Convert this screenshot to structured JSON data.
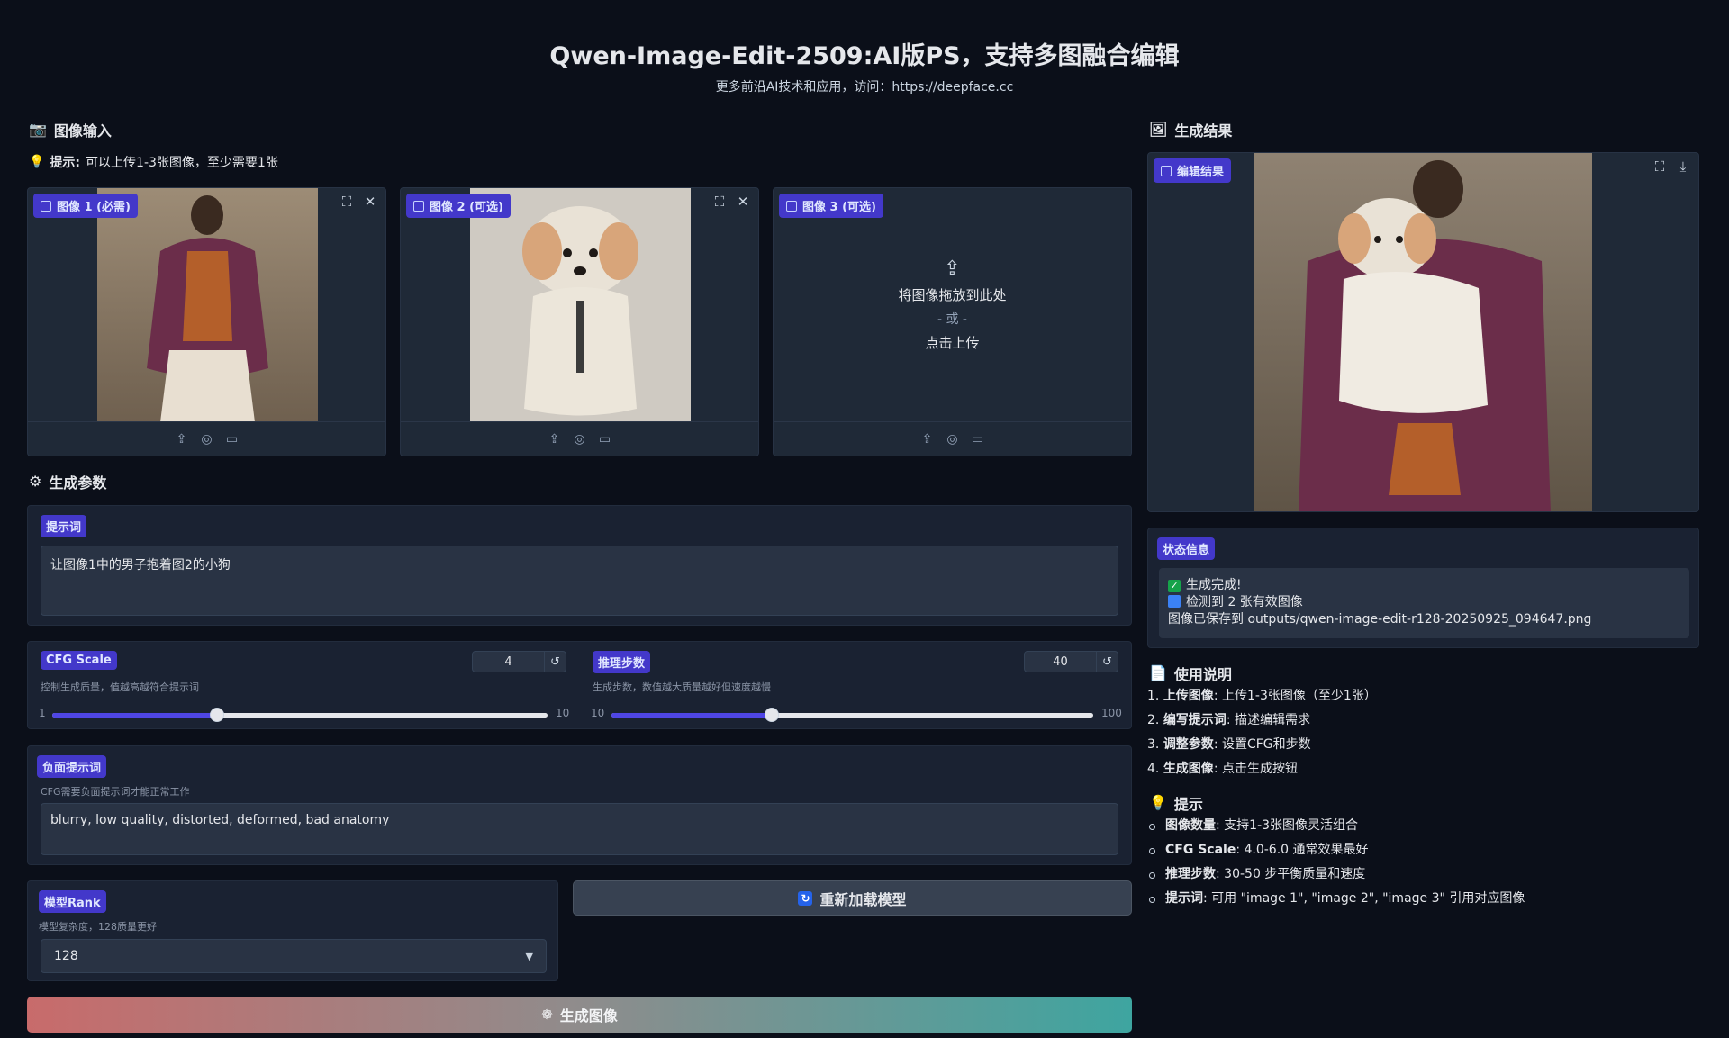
{
  "header": {
    "title": "Qwen-Image-Edit-2509:AI版PS，支持多图融合编辑",
    "subtitle": "更多前沿AI技术和应用，访问：https://deepface.cc"
  },
  "input_section": {
    "title": "图像输入",
    "hint_bold": "提示:",
    "hint_text": "可以上传1-3张图像，至少需要1张",
    "images": [
      {
        "label": "图像 1 (必需)"
      },
      {
        "label": "图像 2 (可选)"
      },
      {
        "label": "图像 3 (可选)"
      }
    ],
    "drop_text": "将图像拖放到此处",
    "drop_or": "- 或 -",
    "drop_click": "点击上传"
  },
  "params": {
    "title": "生成参数",
    "prompt_label": "提示词",
    "prompt_value": "让图像1中的男子抱着图2的小狗",
    "cfg": {
      "label": "CFG Scale",
      "info": "控制生成质量，值越高越符合提示词",
      "value": "4",
      "min": "1",
      "max": "10",
      "fraction": 0.333
    },
    "steps": {
      "label": "推理步数",
      "info": "生成步数，数值越大质量越好但速度越慢",
      "value": "40",
      "min": "10",
      "max": "100",
      "fraction": 0.333
    },
    "neg_label": "负面提示词",
    "neg_info": "CFG需要负面提示词才能正常工作",
    "neg_value": "blurry, low quality, distorted, deformed, bad anatomy",
    "rank_label": "模型Rank",
    "rank_info": "模型复杂度，128质量更好",
    "rank_value": "128",
    "reload_label": "重新加载模型",
    "generate_label": "生成图像"
  },
  "result": {
    "title": "生成结果",
    "image_label": "编辑结果",
    "status_label": "状态信息",
    "status_lines": [
      "生成完成!",
      "检测到 2 张有效图像",
      "图像已保存到 outputs/qwen-image-edit-r128-20250925_094647.png"
    ]
  },
  "usage": {
    "title": "使用说明",
    "steps": [
      {
        "num": "1.",
        "bold": "上传图像",
        "text": ": 上传1-3张图像（至少1张）"
      },
      {
        "num": "2.",
        "bold": "编写提示词",
        "text": ": 描述编辑需求"
      },
      {
        "num": "3.",
        "bold": "调整参数",
        "text": ": 设置CFG和步数"
      },
      {
        "num": "4.",
        "bold": "生成图像",
        "text": ": 点击生成按钮"
      }
    ]
  },
  "tips": {
    "title": "提示",
    "items": [
      {
        "bold": "图像数量",
        "text": ": 支持1-3张图像灵活组合"
      },
      {
        "bold": "CFG Scale",
        "text": ": 4.0-6.0 通常效果最好"
      },
      {
        "bold": "推理步数",
        "text": ": 30-50 步平衡质量和速度"
      },
      {
        "bold": "提示词",
        "text": ": 可用 \"image 1\", \"image 2\", \"image 3\" 引用对应图像"
      }
    ]
  },
  "colors": {
    "background": "#0b0f19",
    "accent": "#4338ca",
    "slider_fill": "#4f46e5"
  }
}
